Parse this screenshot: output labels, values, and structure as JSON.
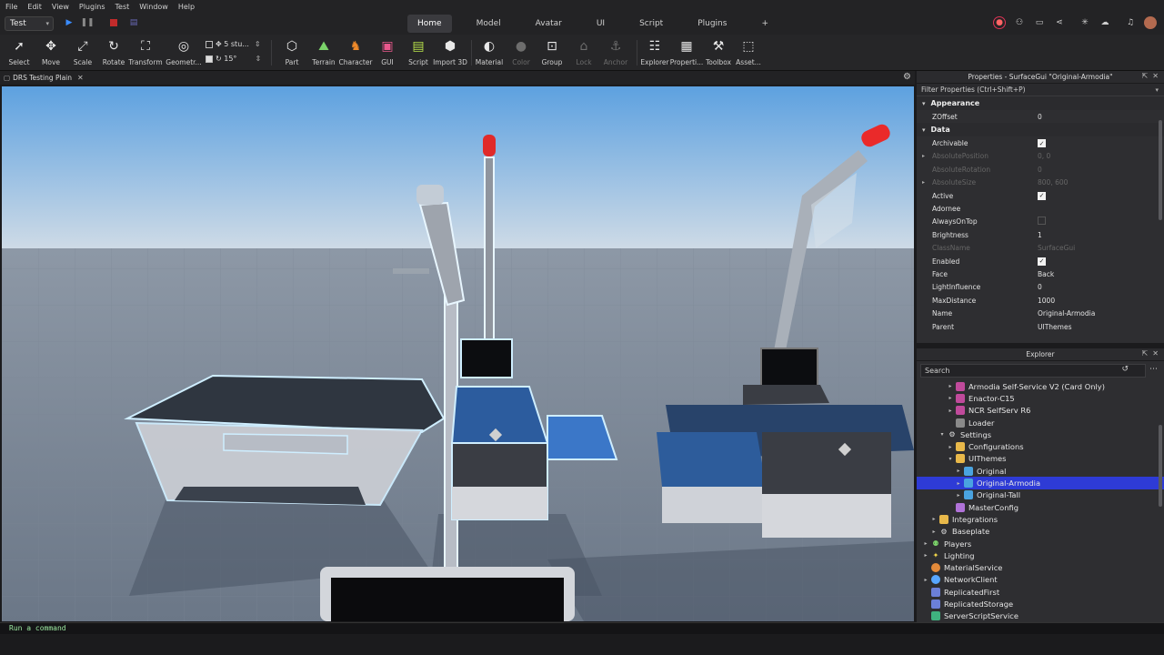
{
  "menu": [
    "File",
    "Edit",
    "View",
    "Plugins",
    "Test",
    "Window",
    "Help"
  ],
  "mode_select": "Test",
  "tabs": [
    {
      "label": "Home",
      "active": true
    },
    {
      "label": "Model",
      "active": false
    },
    {
      "label": "Avatar",
      "active": false
    },
    {
      "label": "UI",
      "active": false
    },
    {
      "label": "Script",
      "active": false
    },
    {
      "label": "Plugins",
      "active": false
    },
    {
      "label": "+",
      "active": false
    }
  ],
  "ribbon": {
    "select": "Select",
    "move": "Move",
    "scale": "Scale",
    "rotate": "Rotate",
    "transform": "Transform",
    "geometry": "Geometr...",
    "snap_move": "5 stu...",
    "snap_rotate": "15°",
    "part": "Part",
    "terrain": "Terrain",
    "character": "Character",
    "gui": "GUI",
    "script": "Script",
    "import3d": "Import 3D",
    "material": "Material",
    "color": "Color",
    "group": "Group",
    "lock": "Lock",
    "anchor": "Anchor",
    "explorer": "Explorer",
    "properties": "Properti...",
    "toolbox": "Toolbox",
    "assets": "Asset..."
  },
  "doc_tab": "DRS Testing Plain",
  "properties": {
    "title": "Properties - SurfaceGui \"Original-Armodia\"",
    "filter": "Filter Properties (Ctrl+Shift+P)",
    "appearance_label": "Appearance",
    "zoffset": {
      "name": "ZOffset",
      "value": "0"
    },
    "data_label": "Data",
    "rows": [
      {
        "name": "Archivable",
        "value": "",
        "check": "on",
        "disabled": false,
        "exp": false
      },
      {
        "name": "AbsolutePosition",
        "value": "0, 0",
        "check": "",
        "disabled": true,
        "exp": true
      },
      {
        "name": "AbsoluteRotation",
        "value": "0",
        "check": "",
        "disabled": true,
        "exp": false
      },
      {
        "name": "AbsoluteSize",
        "value": "800, 600",
        "check": "",
        "disabled": true,
        "exp": true
      },
      {
        "name": "Active",
        "value": "",
        "check": "on",
        "disabled": false,
        "exp": false
      },
      {
        "name": "Adornee",
        "value": "",
        "check": "",
        "disabled": false,
        "exp": false
      },
      {
        "name": "AlwaysOnTop",
        "value": "",
        "check": "off",
        "disabled": false,
        "exp": false
      },
      {
        "name": "Brightness",
        "value": "1",
        "check": "",
        "disabled": false,
        "exp": false
      },
      {
        "name": "ClassName",
        "value": "SurfaceGui",
        "check": "",
        "disabled": true,
        "exp": false
      },
      {
        "name": "Enabled",
        "value": "",
        "check": "on",
        "disabled": false,
        "exp": false
      },
      {
        "name": "Face",
        "value": "Back",
        "check": "",
        "disabled": false,
        "exp": false
      },
      {
        "name": "LightInfluence",
        "value": "0",
        "check": "",
        "disabled": false,
        "exp": false
      },
      {
        "name": "MaxDistance",
        "value": "1000",
        "check": "",
        "disabled": false,
        "exp": false
      },
      {
        "name": "Name",
        "value": "Original-Armodia",
        "check": "",
        "disabled": false,
        "exp": false
      },
      {
        "name": "Parent",
        "value": "UIThemes",
        "check": "",
        "disabled": false,
        "exp": false
      }
    ]
  },
  "explorer": {
    "title": "Explorer",
    "search_placeholder": "Search",
    "items": [
      {
        "label": "Armodia Self-Service V2 (Card Only)",
        "indent": 3,
        "icon": "model",
        "twisty": "▸",
        "selected": false
      },
      {
        "label": "Enactor-C15",
        "indent": 3,
        "icon": "model",
        "twisty": "▸",
        "selected": false
      },
      {
        "label": "NCR SelfServ R6",
        "indent": 3,
        "icon": "model",
        "twisty": "▸",
        "selected": false
      },
      {
        "label": "Loader",
        "indent": 3,
        "icon": "script",
        "twisty": "",
        "selected": false
      },
      {
        "label": "Settings",
        "indent": 2,
        "icon": "gear",
        "twisty": "▾",
        "selected": false
      },
      {
        "label": "Configurations",
        "indent": 3,
        "icon": "folder",
        "twisty": "▸",
        "selected": false
      },
      {
        "label": "UIThemes",
        "indent": 3,
        "icon": "folder",
        "twisty": "▾",
        "selected": false
      },
      {
        "label": "Original",
        "indent": 4,
        "icon": "gui",
        "twisty": "▸",
        "selected": false
      },
      {
        "label": "Original-Armodia",
        "indent": 4,
        "icon": "gui",
        "twisty": "▸",
        "selected": true
      },
      {
        "label": "Original-Tall",
        "indent": 4,
        "icon": "gui",
        "twisty": "▸",
        "selected": false
      },
      {
        "label": "MasterConfig",
        "indent": 3,
        "icon": "module",
        "twisty": "",
        "selected": false
      },
      {
        "label": "Integrations",
        "indent": 1,
        "icon": "folder",
        "twisty": "▸",
        "selected": false
      },
      {
        "label": "Baseplate",
        "indent": 1,
        "icon": "gear",
        "twisty": "▸",
        "selected": false
      },
      {
        "label": "Players",
        "indent": 0,
        "icon": "players",
        "twisty": "▸",
        "selected": false
      },
      {
        "label": "Lighting",
        "indent": 0,
        "icon": "light",
        "twisty": "▸",
        "selected": false
      },
      {
        "label": "MaterialService",
        "indent": 0,
        "icon": "mat",
        "twisty": "",
        "selected": false
      },
      {
        "label": "NetworkClient",
        "indent": 0,
        "icon": "net",
        "twisty": "▸",
        "selected": false
      },
      {
        "label": "ReplicatedFirst",
        "indent": 0,
        "icon": "rep",
        "twisty": "",
        "selected": false
      },
      {
        "label": "ReplicatedStorage",
        "indent": 0,
        "icon": "rep",
        "twisty": "",
        "selected": false
      },
      {
        "label": "ServerScriptService",
        "indent": 0,
        "icon": "svc",
        "twisty": "",
        "selected": false
      }
    ]
  },
  "command_bar": "Run a command",
  "colors": {
    "selection": "#2e3bd6",
    "accent_blue": "#2f7fe0",
    "stop_red": "#c22b2b"
  }
}
